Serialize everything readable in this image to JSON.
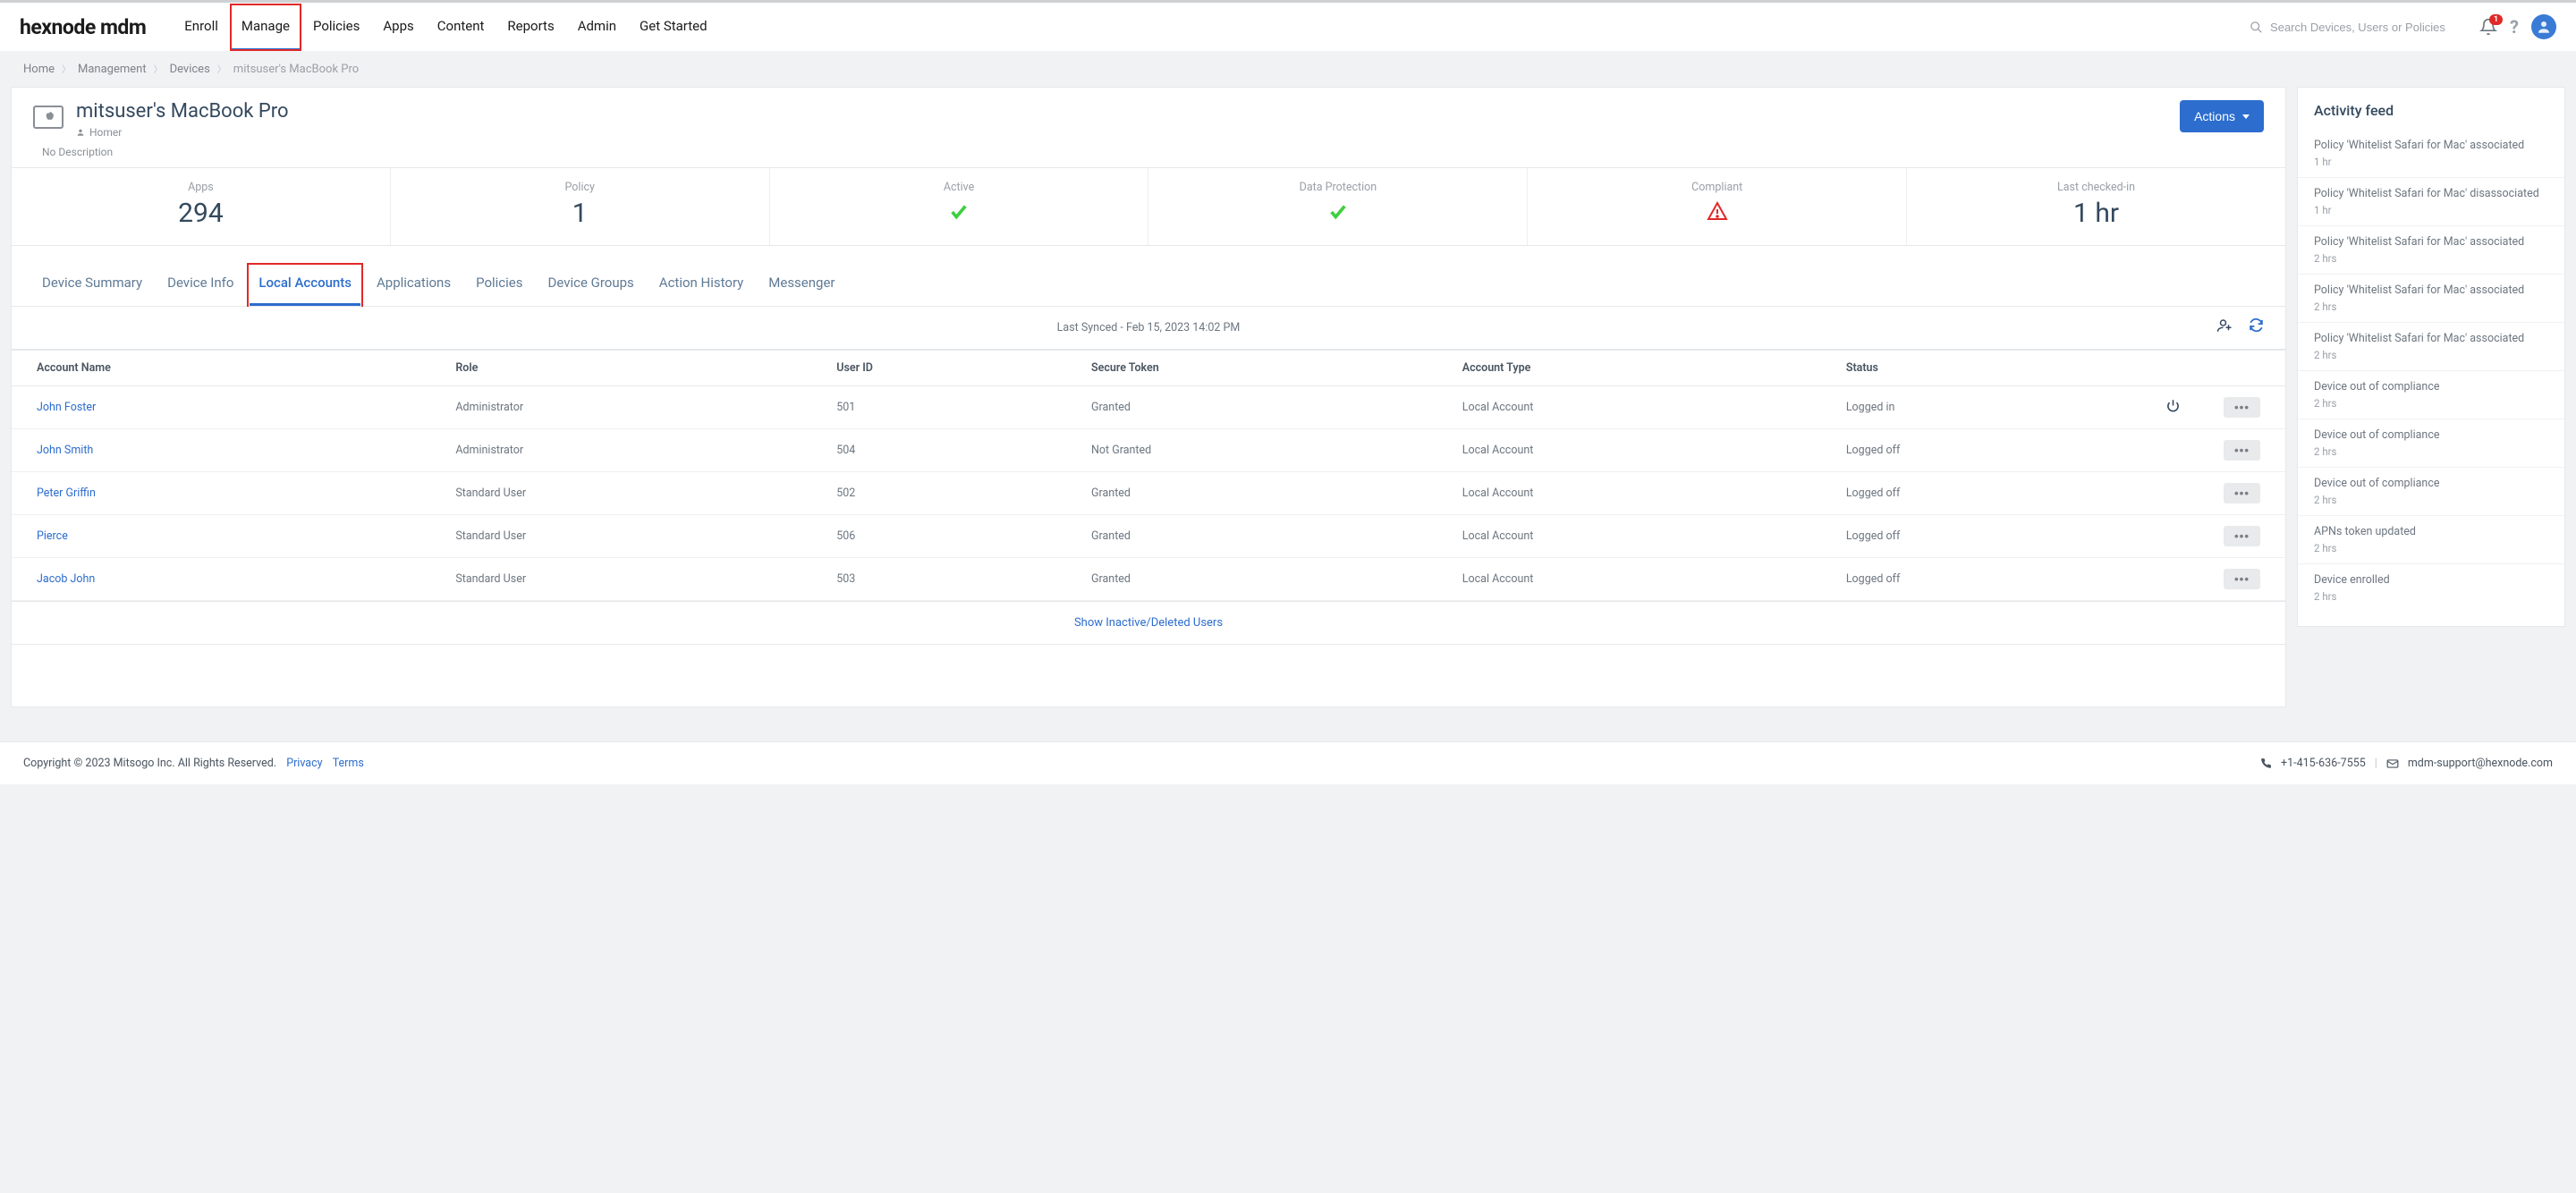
{
  "logo_text": "hexnode mdm",
  "nav": [
    "Enroll",
    "Manage",
    "Policies",
    "Apps",
    "Content",
    "Reports",
    "Admin",
    "Get Started"
  ],
  "nav_active_index": 1,
  "search_placeholder": "Search Devices, Users or Policies",
  "notification_count": "1",
  "breadcrumb": {
    "items": [
      "Home",
      "Management",
      "Devices",
      "mitsuser's MacBook Pro"
    ]
  },
  "device": {
    "name": "mitsuser's MacBook Pro",
    "owner": "Homer",
    "description": "No Description",
    "actions_label": "Actions"
  },
  "stats": [
    {
      "label": "Apps",
      "value": "294",
      "type": "text"
    },
    {
      "label": "Policy",
      "value": "1",
      "type": "text"
    },
    {
      "label": "Active",
      "type": "check"
    },
    {
      "label": "Data Protection",
      "type": "check"
    },
    {
      "label": "Compliant",
      "type": "warn"
    },
    {
      "label": "Last checked-in",
      "value": "1 hr",
      "type": "text"
    }
  ],
  "tabs": [
    "Device Summary",
    "Device Info",
    "Local Accounts",
    "Applications",
    "Policies",
    "Device Groups",
    "Action History",
    "Messenger"
  ],
  "tabs_active_index": 2,
  "sync_text": "Last Synced - Feb 15, 2023 14:02 PM",
  "table": {
    "columns": [
      "Account Name",
      "Role",
      "User ID",
      "Secure Token",
      "Account Type",
      "Status"
    ],
    "rows": [
      {
        "name": "John Foster",
        "role": "Administrator",
        "uid": "501",
        "token": "Granted",
        "atype": "Local Account",
        "status": "Logged in",
        "power": true
      },
      {
        "name": "John Smith",
        "role": "Administrator",
        "uid": "504",
        "token": "Not Granted",
        "atype": "Local Account",
        "status": "Logged off",
        "power": false
      },
      {
        "name": "Peter Griffin",
        "role": "Standard User",
        "uid": "502",
        "token": "Granted",
        "atype": "Local Account",
        "status": "Logged off",
        "power": false
      },
      {
        "name": "Pierce",
        "role": "Standard User",
        "uid": "506",
        "token": "Granted",
        "atype": "Local Account",
        "status": "Logged off",
        "power": false
      },
      {
        "name": "Jacob John",
        "role": "Standard User",
        "uid": "503",
        "token": "Granted",
        "atype": "Local Account",
        "status": "Logged off",
        "power": false
      }
    ]
  },
  "show_inactive_label": "Show Inactive/Deleted Users",
  "activity": {
    "heading": "Activity feed",
    "items": [
      {
        "title": "Policy 'Whitelist Safari for Mac' associated",
        "time": "1 hr"
      },
      {
        "title": "Policy 'Whitelist Safari for Mac' disassociated",
        "time": "1 hr"
      },
      {
        "title": "Policy 'Whitelist Safari for Mac' associated",
        "time": "2 hrs"
      },
      {
        "title": "Policy 'Whitelist Safari for Mac' associated",
        "time": "2 hrs"
      },
      {
        "title": "Policy 'Whitelist Safari for Mac' associated",
        "time": "2 hrs"
      },
      {
        "title": "Device out of compliance",
        "time": "2 hrs"
      },
      {
        "title": "Device out of compliance",
        "time": "2 hrs"
      },
      {
        "title": "Device out of compliance",
        "time": "2 hrs"
      },
      {
        "title": "APNs token updated",
        "time": "2 hrs"
      },
      {
        "title": "Device enrolled",
        "time": "2 hrs"
      }
    ]
  },
  "footer": {
    "copyright": "Copyright © 2023 Mitsogo Inc. All Rights Reserved.",
    "links": [
      "Privacy",
      "Terms"
    ],
    "phone": "+1-415-636-7555",
    "email": "mdm-support@hexnode.com"
  }
}
